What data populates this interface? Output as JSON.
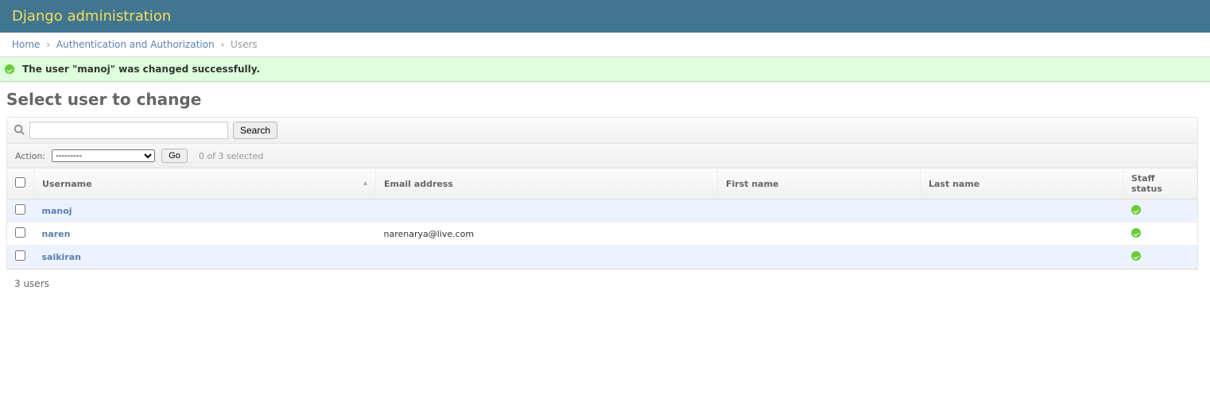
{
  "header": {
    "title": "Django administration"
  },
  "breadcrumbs": {
    "home": "Home",
    "auth": "Authentication and Authorization",
    "current": "Users"
  },
  "message": "The user \"manoj\" was changed successfully.",
  "page_title": "Select user to change",
  "search": {
    "button": "Search",
    "value": ""
  },
  "actions": {
    "label": "Action:",
    "empty_option": "---------",
    "go": "Go",
    "counter": "0 of 3 selected"
  },
  "columns": {
    "username": "Username",
    "email": "Email address",
    "first_name": "First name",
    "last_name": "Last name",
    "staff": "Staff status"
  },
  "rows": [
    {
      "username": "manoj",
      "email": "",
      "first_name": "",
      "last_name": "",
      "staff": true
    },
    {
      "username": "naren",
      "email": "narenarya@live.com",
      "first_name": "",
      "last_name": "",
      "staff": true
    },
    {
      "username": "saikiran",
      "email": "",
      "first_name": "",
      "last_name": "",
      "staff": true
    }
  ],
  "paginator": "3 users"
}
